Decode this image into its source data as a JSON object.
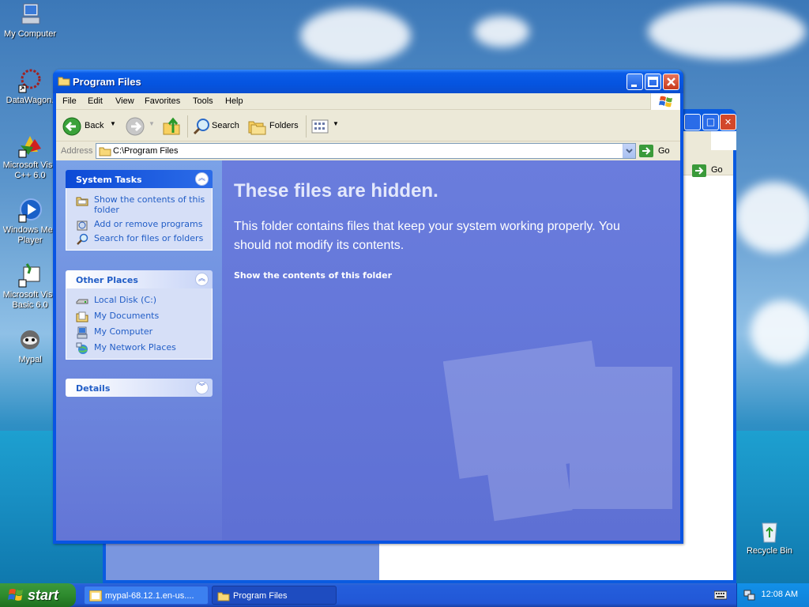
{
  "desktop": {
    "icons": [
      {
        "label": "My Computer"
      },
      {
        "label": "DataWagon."
      },
      {
        "label": "Microsoft Visu C++ 6.0"
      },
      {
        "label": "Windows Mec Player"
      },
      {
        "label": "Microsoft Visu Basic 6.0"
      },
      {
        "label": "Mypal"
      },
      {
        "label": "Recycle Bin"
      }
    ]
  },
  "window": {
    "title": "Program Files",
    "menu": [
      "File",
      "Edit",
      "View",
      "Favorites",
      "Tools",
      "Help"
    ],
    "toolbar": {
      "back": "Back",
      "search": "Search",
      "folders": "Folders"
    },
    "address": {
      "label": "Address",
      "value": "C:\\Program Files",
      "go": "Go"
    },
    "tasks": {
      "system_title": "System Tasks",
      "system_items": [
        "Show the contents of this folder",
        "Add or remove programs",
        "Search for files or folders"
      ],
      "places_title": "Other Places",
      "places_items": [
        "Local Disk (C:)",
        "My Documents",
        "My Computer",
        "My Network Places"
      ],
      "details_title": "Details"
    },
    "content": {
      "heading": "These files are hidden.",
      "message": "This folder contains files that keep your system working properly. You should not modify its contents.",
      "link": "Show the contents of this folder"
    }
  },
  "back_window": {
    "go": "Go"
  },
  "taskbar": {
    "start": "start",
    "tasks": [
      "mypal-68.12.1.en-us....",
      "Program Files"
    ],
    "clock": "12:08 AM"
  }
}
